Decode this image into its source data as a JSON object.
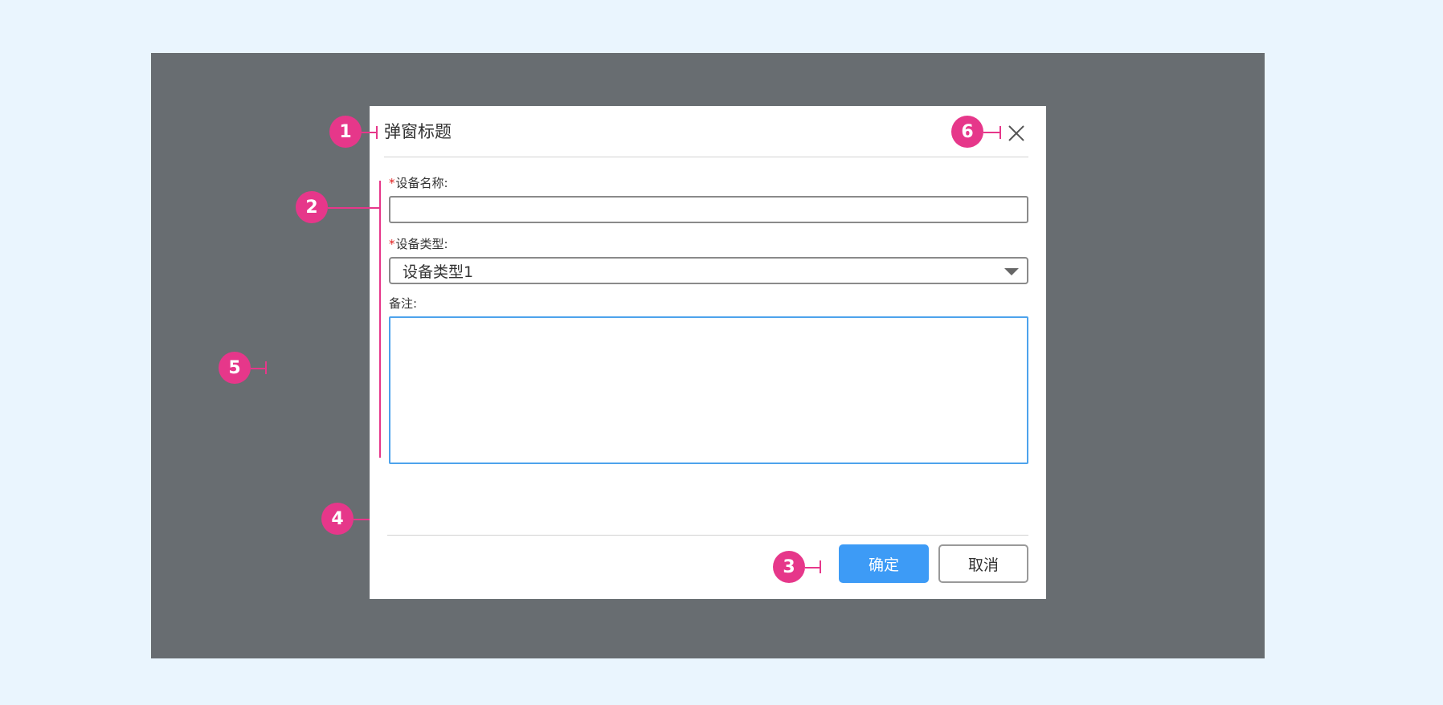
{
  "dialog": {
    "title": "弹窗标题",
    "close_icon": "close-icon",
    "fields": {
      "device_name": {
        "required_mark": "*",
        "label": "设备名称:"
      },
      "device_type": {
        "required_mark": "*",
        "label": "设备类型:",
        "selected": "设备类型1"
      },
      "remark": {
        "label": "备注:"
      }
    },
    "buttons": {
      "confirm": "确定",
      "cancel": "取消"
    }
  },
  "annotations": [
    "1",
    "2",
    "3",
    "4",
    "5",
    "6"
  ],
  "colors": {
    "background": "#eaf5fe",
    "overlay": "#686d71",
    "primary": "#3d9bf6",
    "required": "#e02020",
    "focus_border": "#4da3ec",
    "annotation": "#e6378a"
  }
}
